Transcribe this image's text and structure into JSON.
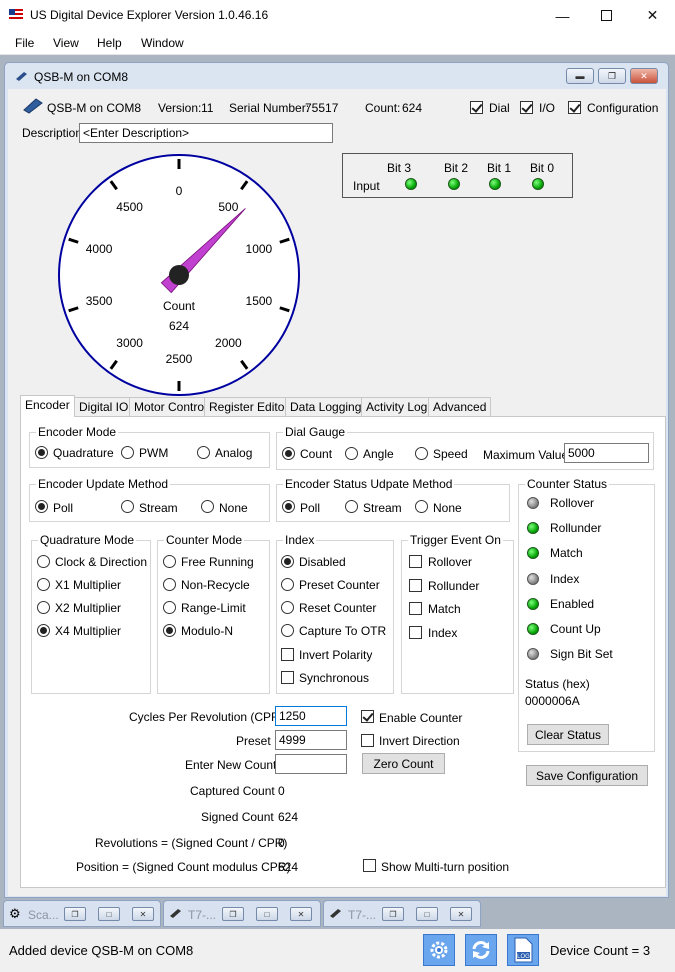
{
  "app": {
    "title": "US Digital Device Explorer Version 1.0.46.16"
  },
  "menu": {
    "file": "File",
    "view": "View",
    "help": "Help",
    "window": "Window"
  },
  "child": {
    "title": "QSB-M on COM8"
  },
  "device": {
    "name": "QSB-M on COM8",
    "version_label": "Version:",
    "version": "11",
    "serial_label": "Serial Number:",
    "serial": "75517",
    "count_label": "Count:",
    "count": "624",
    "dial_label": "Dial",
    "io_label": "I/O",
    "config_label": "Configuration",
    "description_label": "Description",
    "description_value": "<Enter Description>"
  },
  "input_panel": {
    "label": "Input",
    "bits": [
      "Bit 3",
      "Bit 2",
      "Bit 1",
      "Bit 0"
    ],
    "states": [
      1,
      1,
      1,
      1
    ],
    "led_color": "#08a808"
  },
  "gauge": {
    "labels": [
      "0",
      "500",
      "1000",
      "1500",
      "2000",
      "2500",
      "3000",
      "3500",
      "4000",
      "4500"
    ],
    "max": 5000,
    "value": 624,
    "center_label": "Count",
    "center_value": "624",
    "ring_color": "#0000a0",
    "needle_color": "#c040d0"
  },
  "tabs": [
    "Encoder",
    "Digital IO",
    "Motor Control",
    "Register Editor",
    "Data Logging",
    "Activity Log",
    "Advanced"
  ],
  "encoder_mode": {
    "title": "Encoder Mode",
    "options": [
      "Quadrature",
      "PWM",
      "Analog"
    ],
    "selected": 0
  },
  "dial_gauge": {
    "title": "Dial Gauge",
    "options": [
      "Count",
      "Angle",
      "Speed"
    ],
    "selected": 0,
    "max_label": "Maximum Value",
    "max_value": "5000"
  },
  "update_method": {
    "title": "Encoder Update Method",
    "options": [
      "Poll",
      "Stream",
      "None"
    ],
    "selected": 0
  },
  "status_update_method": {
    "title": "Encoder Status Udpate Method",
    "options": [
      "Poll",
      "Stream",
      "None"
    ],
    "selected": 0
  },
  "counter_status": {
    "title": "Counter Status",
    "items": [
      {
        "label": "Rollover",
        "on": false
      },
      {
        "label": "Rollunder",
        "on": true
      },
      {
        "label": "Match",
        "on": true
      },
      {
        "label": "Index",
        "on": false
      },
      {
        "label": "Enabled",
        "on": true
      },
      {
        "label": "Count Up",
        "on": true
      },
      {
        "label": "Sign Bit Set",
        "on": false
      }
    ],
    "hex_label": "Status (hex)",
    "hex_value": "0000006A",
    "clear_label": "Clear Status"
  },
  "save_config_label": "Save Configuration",
  "quadrature_mode": {
    "title": "Quadrature Mode",
    "options": [
      "Clock & Direction",
      "X1 Multiplier",
      "X2 Multiplier",
      "X4 Multiplier"
    ],
    "selected": 3
  },
  "counter_mode": {
    "title": "Counter Mode",
    "options": [
      "Free Running",
      "Non-Recycle",
      "Range-Limit",
      "Modulo-N"
    ],
    "selected": 3
  },
  "index": {
    "title": "Index",
    "options": [
      "Disabled",
      "Preset Counter",
      "Reset Counter",
      "Capture To OTR"
    ],
    "selected": 0,
    "checks": [
      "Invert Polarity",
      "Synchronous"
    ]
  },
  "trigger": {
    "title": "Trigger Event On",
    "checks": [
      "Rollover",
      "Rollunder",
      "Match",
      "Index"
    ]
  },
  "fields": {
    "cpr_label": "Cycles Per Revolution (CPR)",
    "cpr_value": "1250",
    "preset_label": "Preset",
    "preset_value": "4999",
    "new_count_label": "Enter New Count",
    "new_count_value": "",
    "enable_counter": "Enable Counter",
    "invert_direction": "Invert Direction",
    "zero_count": "Zero Count",
    "captured_label": "Captured Count",
    "captured_value": "0",
    "signed_label": "Signed Count",
    "signed_value": "624",
    "revs_label": "Revolutions = (Signed Count / CPR)",
    "revs_value": "0",
    "pos_label": "Position = (Signed Count modulus  CPR)",
    "pos_value": "624",
    "multiturn": "Show Multi-turn position"
  },
  "minis": [
    "Sca...",
    "T7-...",
    "T7-..."
  ],
  "status": {
    "message": "Added device QSB-M on COM8",
    "device_count": "Device Count = 3"
  }
}
